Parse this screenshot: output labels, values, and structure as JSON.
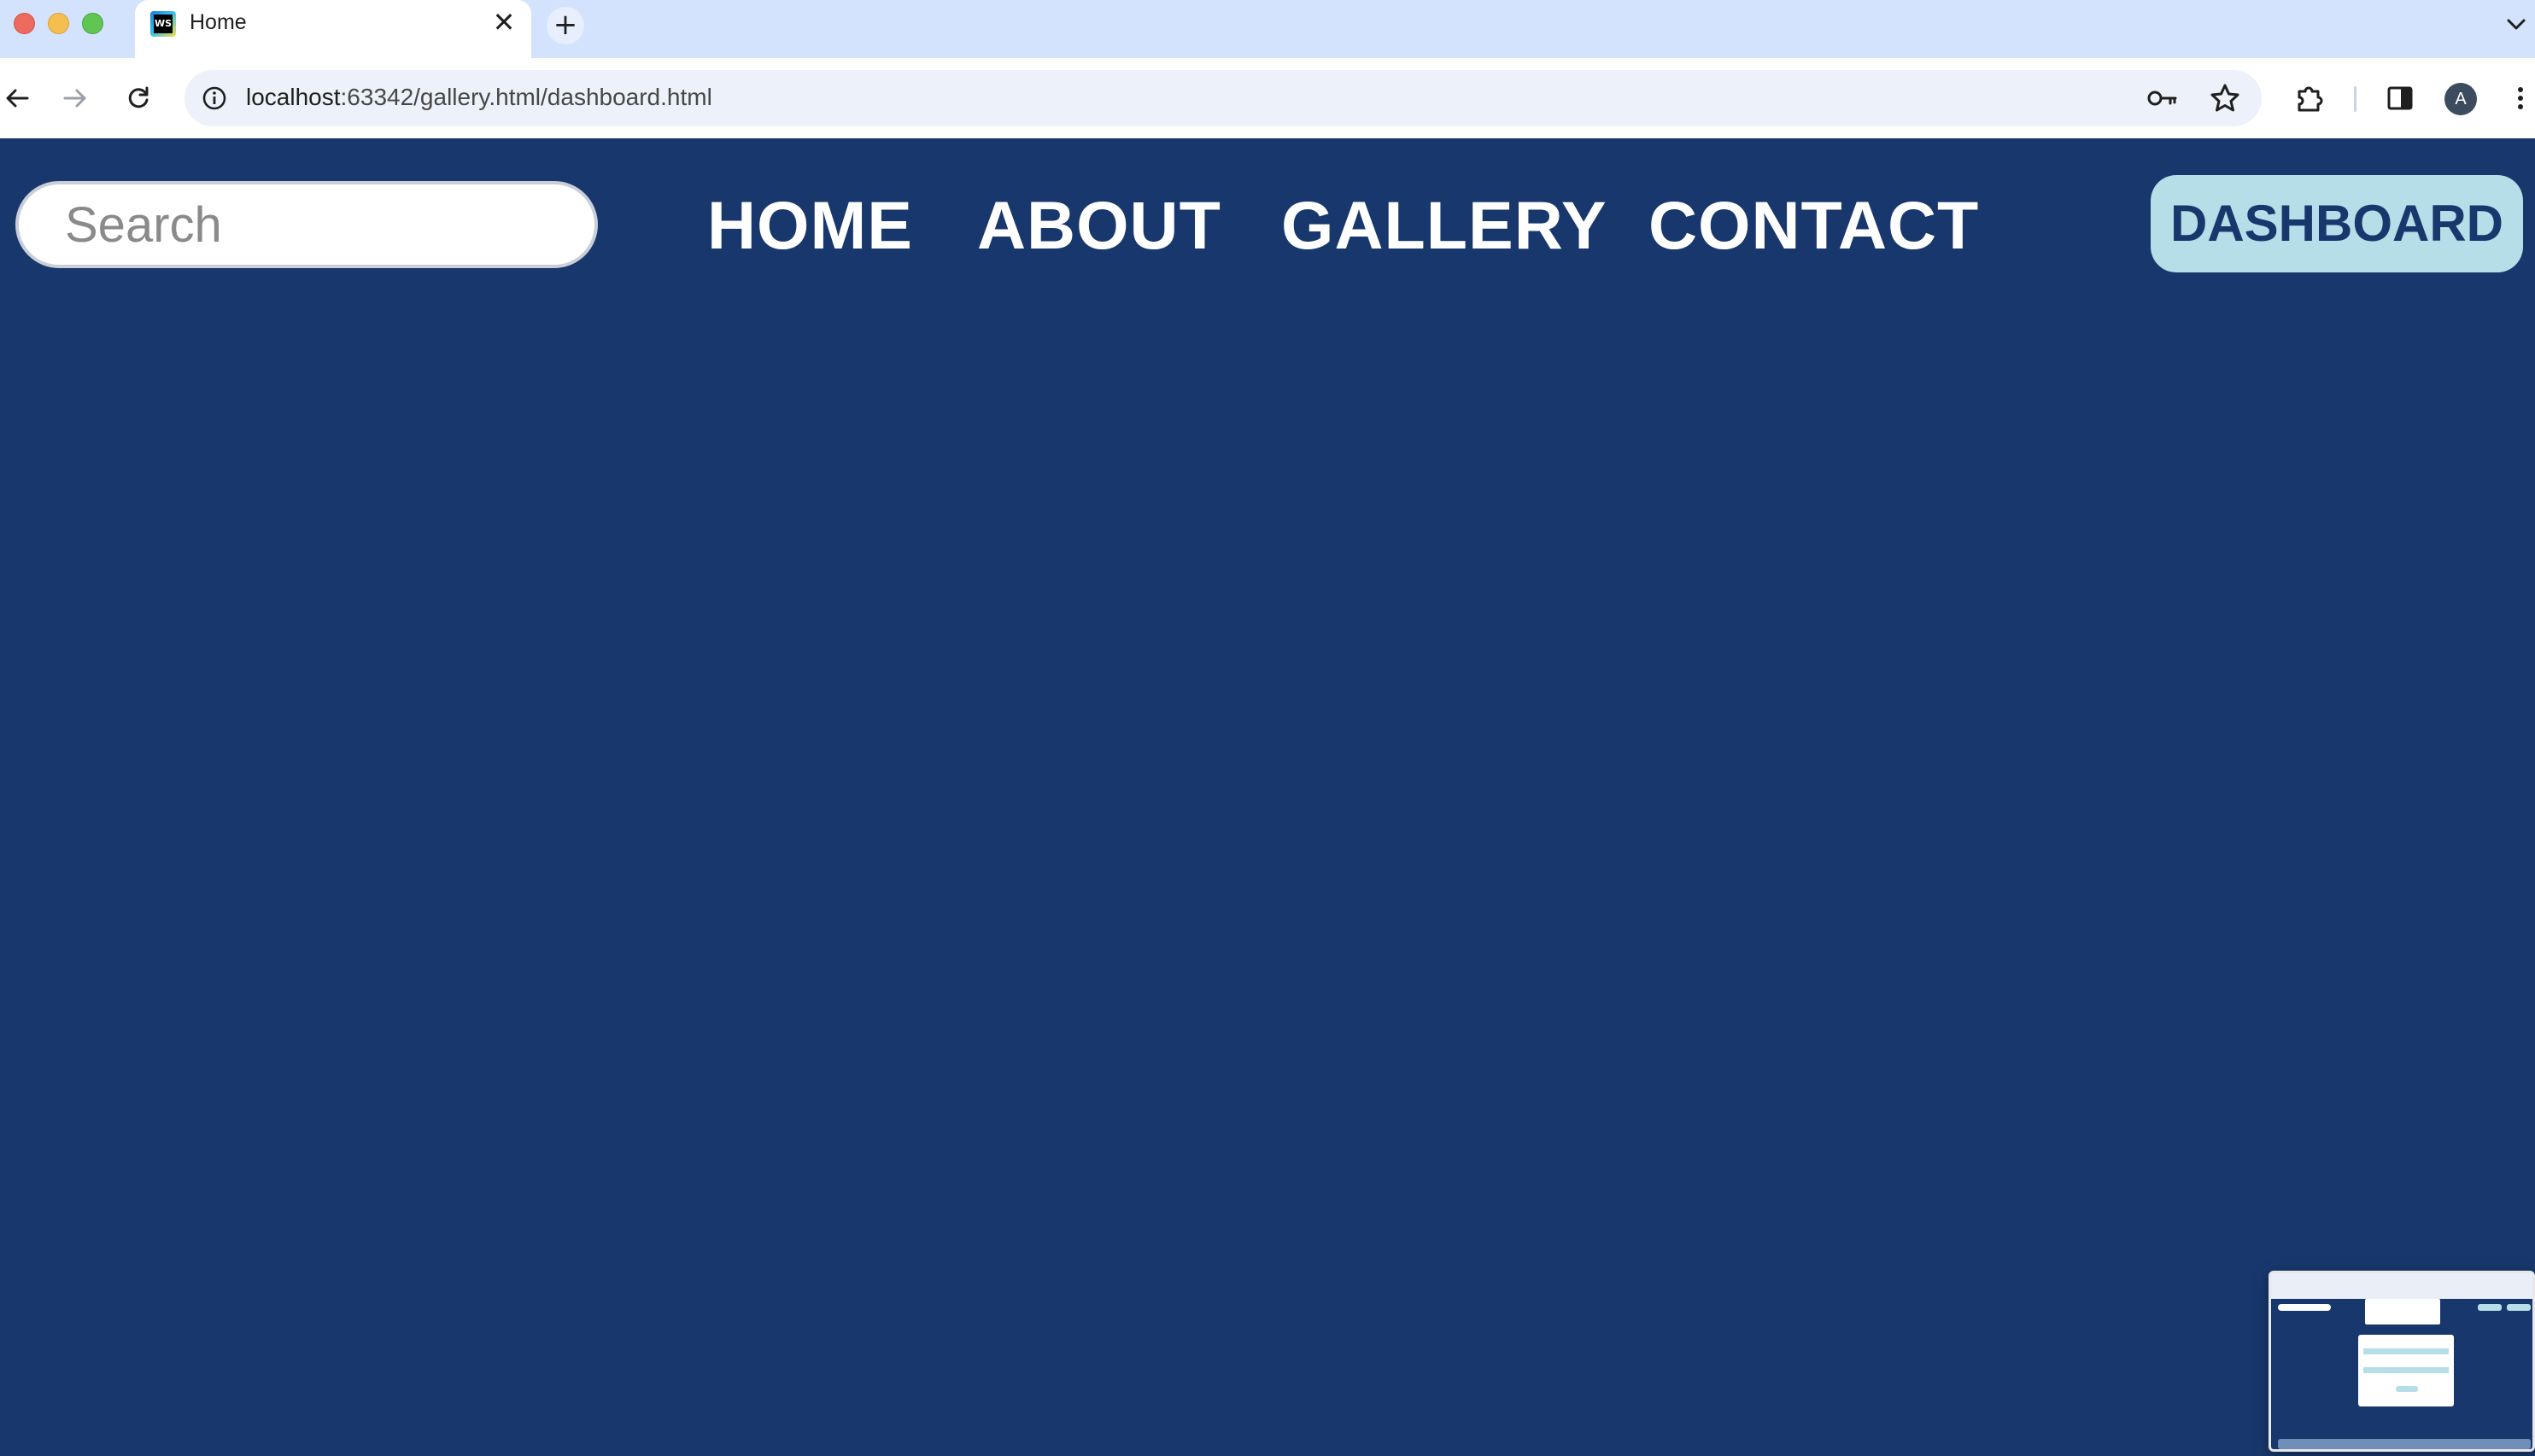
{
  "browser": {
    "tab": {
      "title": "Home",
      "favicon": "webstorm-icon"
    },
    "new_tab_symbol": "+",
    "close_symbol": "✕",
    "url": {
      "host": "localhost",
      "rest": ":63342/gallery.html/dashboard.html"
    },
    "profile_initial": "A",
    "icons": [
      "back-icon",
      "forward-icon",
      "reload-icon",
      "site-info-icon",
      "key-icon",
      "star-icon",
      "extensions-icon",
      "side-panel-icon",
      "menu-icon",
      "tab-search-icon"
    ]
  },
  "page": {
    "background_color": "#18386d",
    "search": {
      "placeholder": "Search",
      "value": ""
    },
    "nav": {
      "home": "HOME",
      "about": "ABOUT",
      "gallery": "GALLERY",
      "contact": "CONTACT"
    },
    "dashboard_button": "DASHBOARD",
    "accent_color": "#b6dee8"
  }
}
